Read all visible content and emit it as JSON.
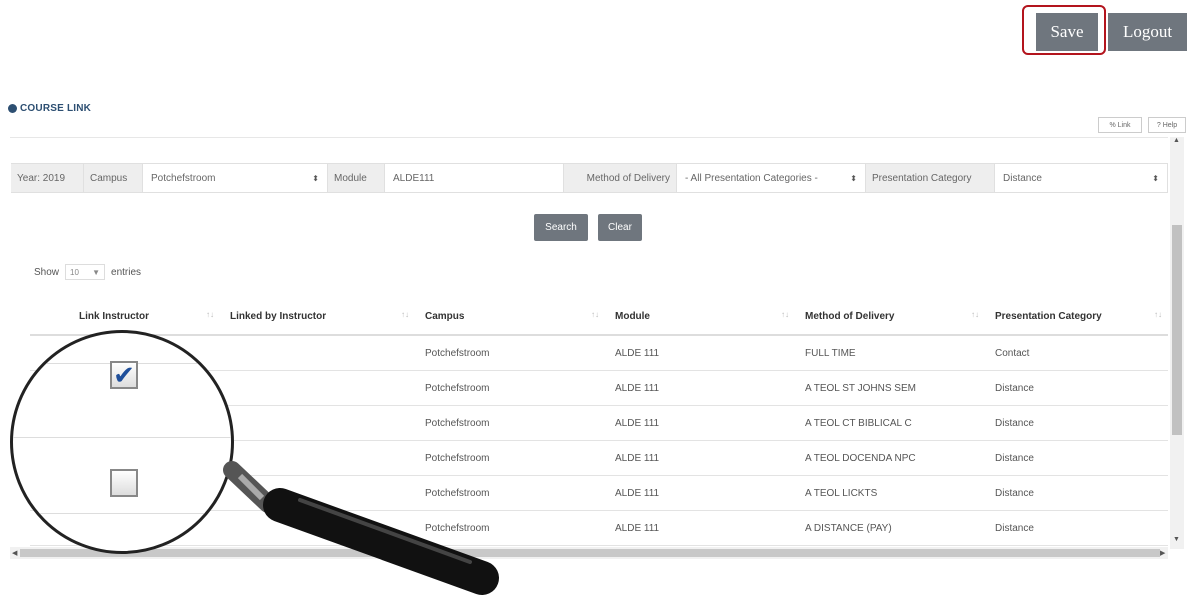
{
  "header": {
    "save_label": "Save",
    "logout_label": "Logout"
  },
  "page": {
    "title": "COURSE LINK",
    "link_label": "% Link",
    "help_label": "? Help"
  },
  "filters": {
    "year": "Year: 2019",
    "campus_label": "Campus",
    "campus_value": "Potchefstroom",
    "module_label": "Module",
    "module_value": "ALDE111",
    "delivery_label": "Method of Delivery",
    "delivery_value": "- All Presentation Categories -",
    "category_label": "Presentation Category",
    "category_value": "Distance"
  },
  "actions": {
    "search_label": "Search",
    "clear_label": "Clear"
  },
  "entries": {
    "show_label": "Show",
    "count": "10",
    "entries_label": "entries"
  },
  "table": {
    "columns": [
      "Link Instructor",
      "Linked by Instructor",
      "Campus",
      "Module",
      "Method of Delivery",
      "Presentation Category"
    ],
    "rows": [
      {
        "campus": "Potchefstroom",
        "module": "ALDE 111",
        "delivery": "FULL TIME",
        "category": "Contact"
      },
      {
        "campus": "Potchefstroom",
        "module": "ALDE 111",
        "delivery": "A TEOL ST JOHNS SEM",
        "category": "Distance"
      },
      {
        "campus": "Potchefstroom",
        "module": "ALDE 111",
        "delivery": "A TEOL CT BIBLICAL C",
        "category": "Distance"
      },
      {
        "campus": "Potchefstroom",
        "module": "ALDE 111",
        "delivery": "A TEOL DOCENDA NPC",
        "category": "Distance"
      },
      {
        "campus": "Potchefstroom",
        "module": "ALDE 111",
        "delivery": "A TEOL LICKTS",
        "category": "Distance"
      },
      {
        "campus": "Potchefstroom",
        "module": "ALDE 111",
        "delivery": "A DISTANCE (PAY)",
        "category": "Distance"
      }
    ]
  },
  "magnifier": {
    "checkbox_checked": true,
    "checkbox_unchecked": false
  },
  "colors": {
    "button": "#6f767e",
    "highlight": "#b3141d",
    "title": "#2d4f72"
  }
}
